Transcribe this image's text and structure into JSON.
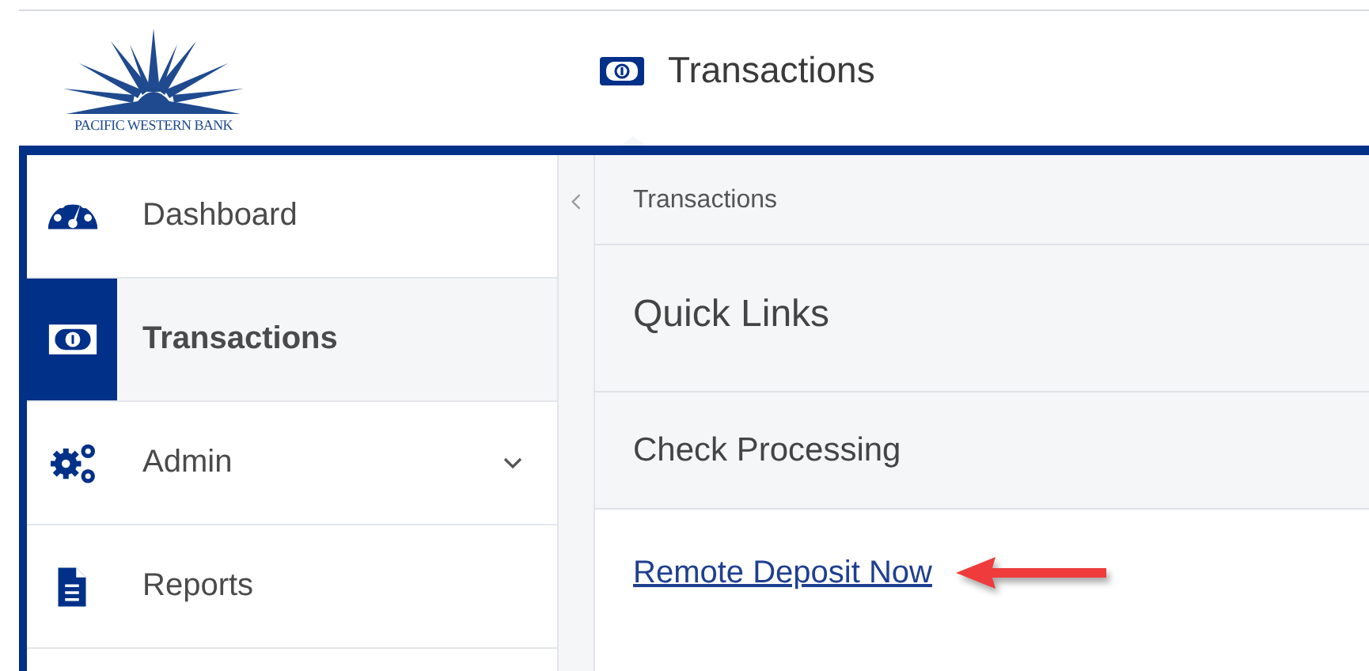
{
  "logo": {
    "text": "PACIFIC WESTERN BANK"
  },
  "header": {
    "title": "Transactions"
  },
  "sidebar": {
    "items": [
      {
        "label": "Dashboard",
        "selected": false,
        "expandable": false
      },
      {
        "label": "Transactions",
        "selected": true,
        "expandable": false
      },
      {
        "label": "Admin",
        "selected": false,
        "expandable": true
      },
      {
        "label": "Reports",
        "selected": false,
        "expandable": false
      }
    ]
  },
  "content": {
    "breadcrumb": "Transactions",
    "sections": [
      {
        "kind": "heading",
        "title": "Quick Links"
      },
      {
        "kind": "subheading",
        "title": "Check Processing"
      }
    ],
    "links": [
      "Remote Deposit Now"
    ]
  }
}
